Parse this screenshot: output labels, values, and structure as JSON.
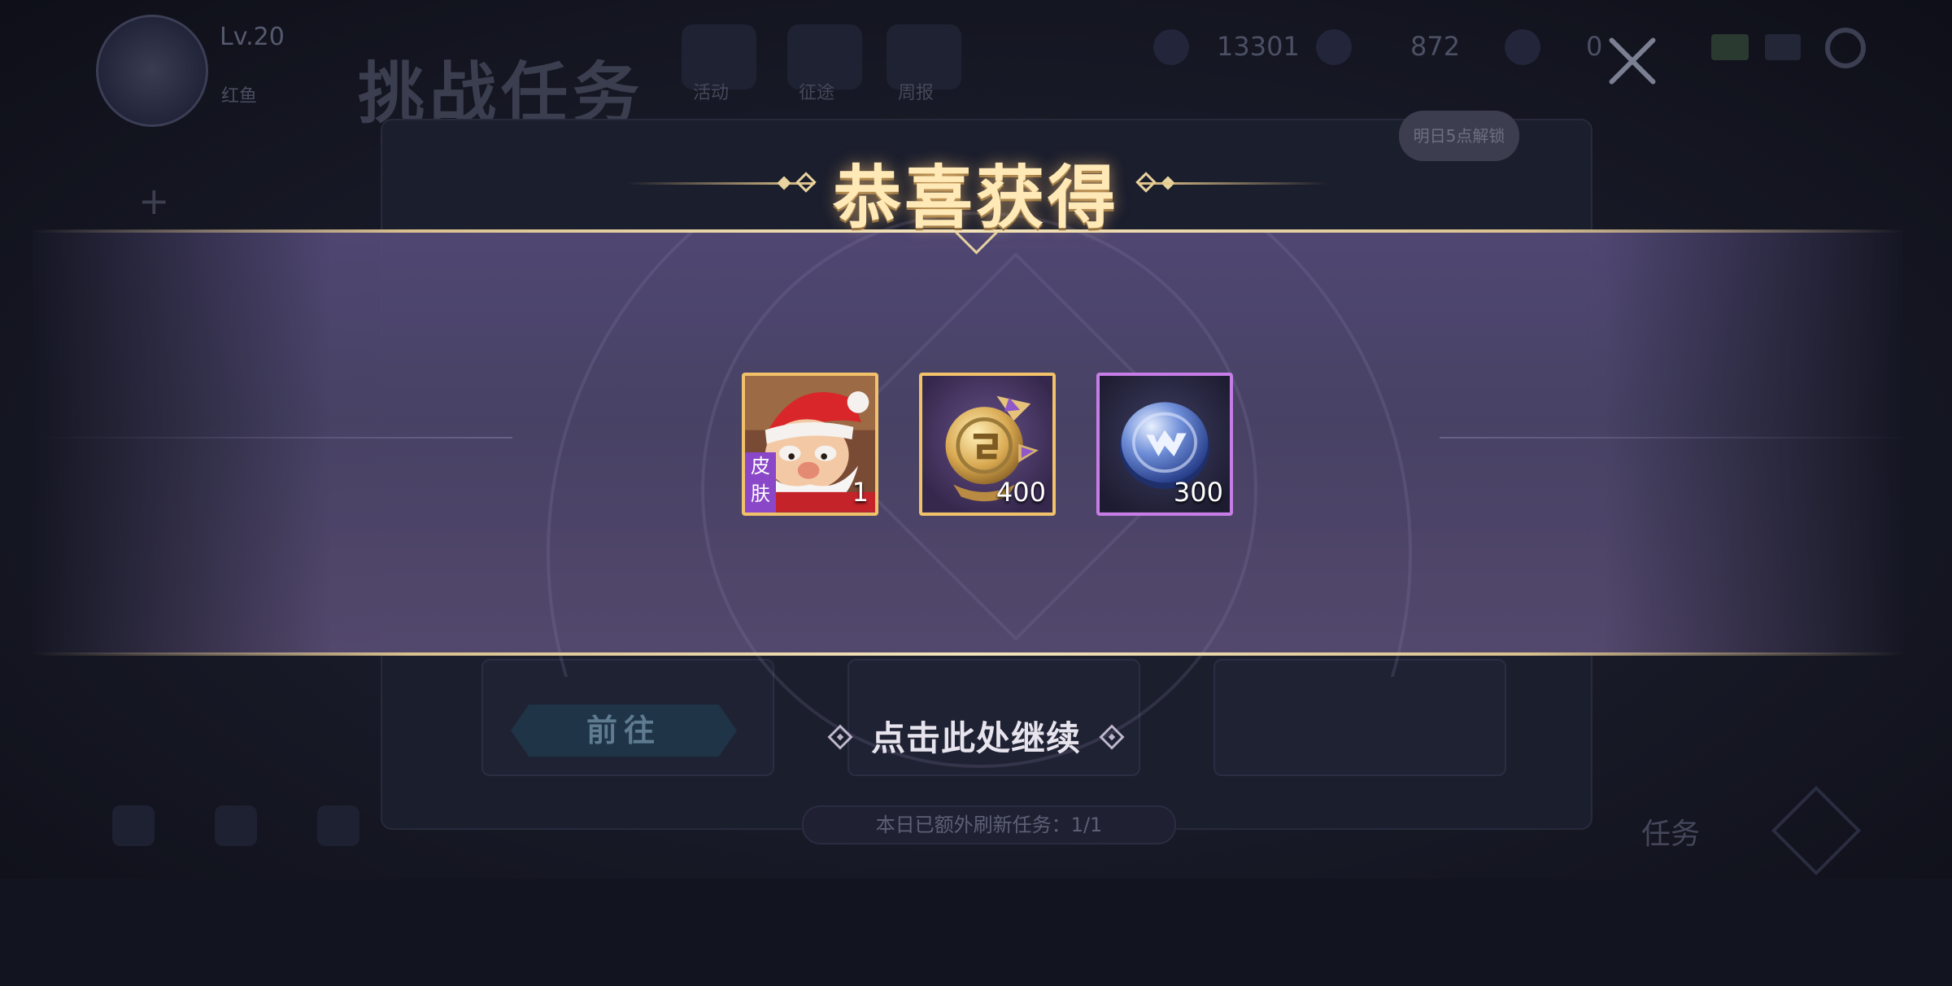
{
  "background": {
    "player_level": "Lv.20",
    "player_sub": "红鱼",
    "page_title": "挑战任务",
    "top_nav": [
      "活动",
      "征途",
      "周报"
    ],
    "currency_1": "13301",
    "currency_2": "872",
    "currency_3": "0",
    "unlock_bubble": "明日5点解锁",
    "go_button": "前往",
    "footer_info": "本日已额外刷新任务：1/1",
    "bottom_task_label": "任务"
  },
  "popup": {
    "title": "恭喜获得",
    "rewards": [
      {
        "icon": "santa-skin-icon",
        "tag": "皮肤",
        "count": "1",
        "frame": "#f1c26a"
      },
      {
        "icon": "gold-medal-coin-icon",
        "count": "400",
        "frame": "#f1c26a"
      },
      {
        "icon": "blue-coin-icon",
        "count": "300",
        "frame": "#c77de6"
      }
    ],
    "continue_label": "点击此处继续"
  }
}
